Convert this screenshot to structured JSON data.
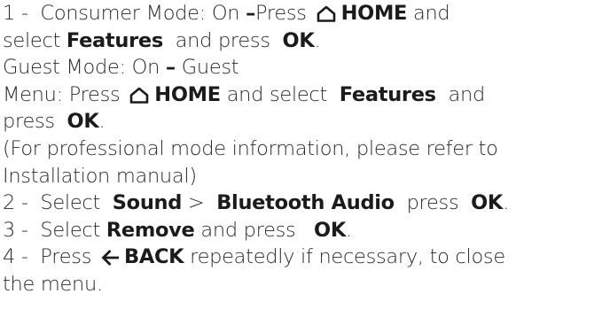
{
  "step1": {
    "num": "1 -",
    "consumer_label": "Consumer Mode: On",
    "dash": "–",
    "press": "Press",
    "home_icon": "home-icon",
    "home": "HOME",
    "and": "and",
    "select": "select",
    "features": "Features",
    "and_press": "and press",
    "ok": "OK",
    "period": ".",
    "guest_label": "Guest Mode: On",
    "guest": "Guest",
    "menu_press": "Menu: Press",
    "and_select": "and select",
    "and2": "and",
    "press2": "press",
    "professional": "(For professional mode information, please refer to",
    "installation": "Installation manual)"
  },
  "step2": {
    "num": "2 -",
    "select": "Select",
    "sound": "Sound",
    "gt": ">",
    "bluetooth": "Bluetooth Audio",
    "press": "press",
    "ok": "OK",
    "period": "."
  },
  "step3": {
    "num": "3 -",
    "select": "Select",
    "remove": "Remove",
    "and_press": "and press",
    "ok": "OK",
    "period": "."
  },
  "step4": {
    "num": "4 -",
    "press": "Press",
    "back_icon": "back-arrow-icon",
    "back": "BACK",
    "rest": "repeatedly if necessary, to close",
    "menu": "the menu."
  }
}
